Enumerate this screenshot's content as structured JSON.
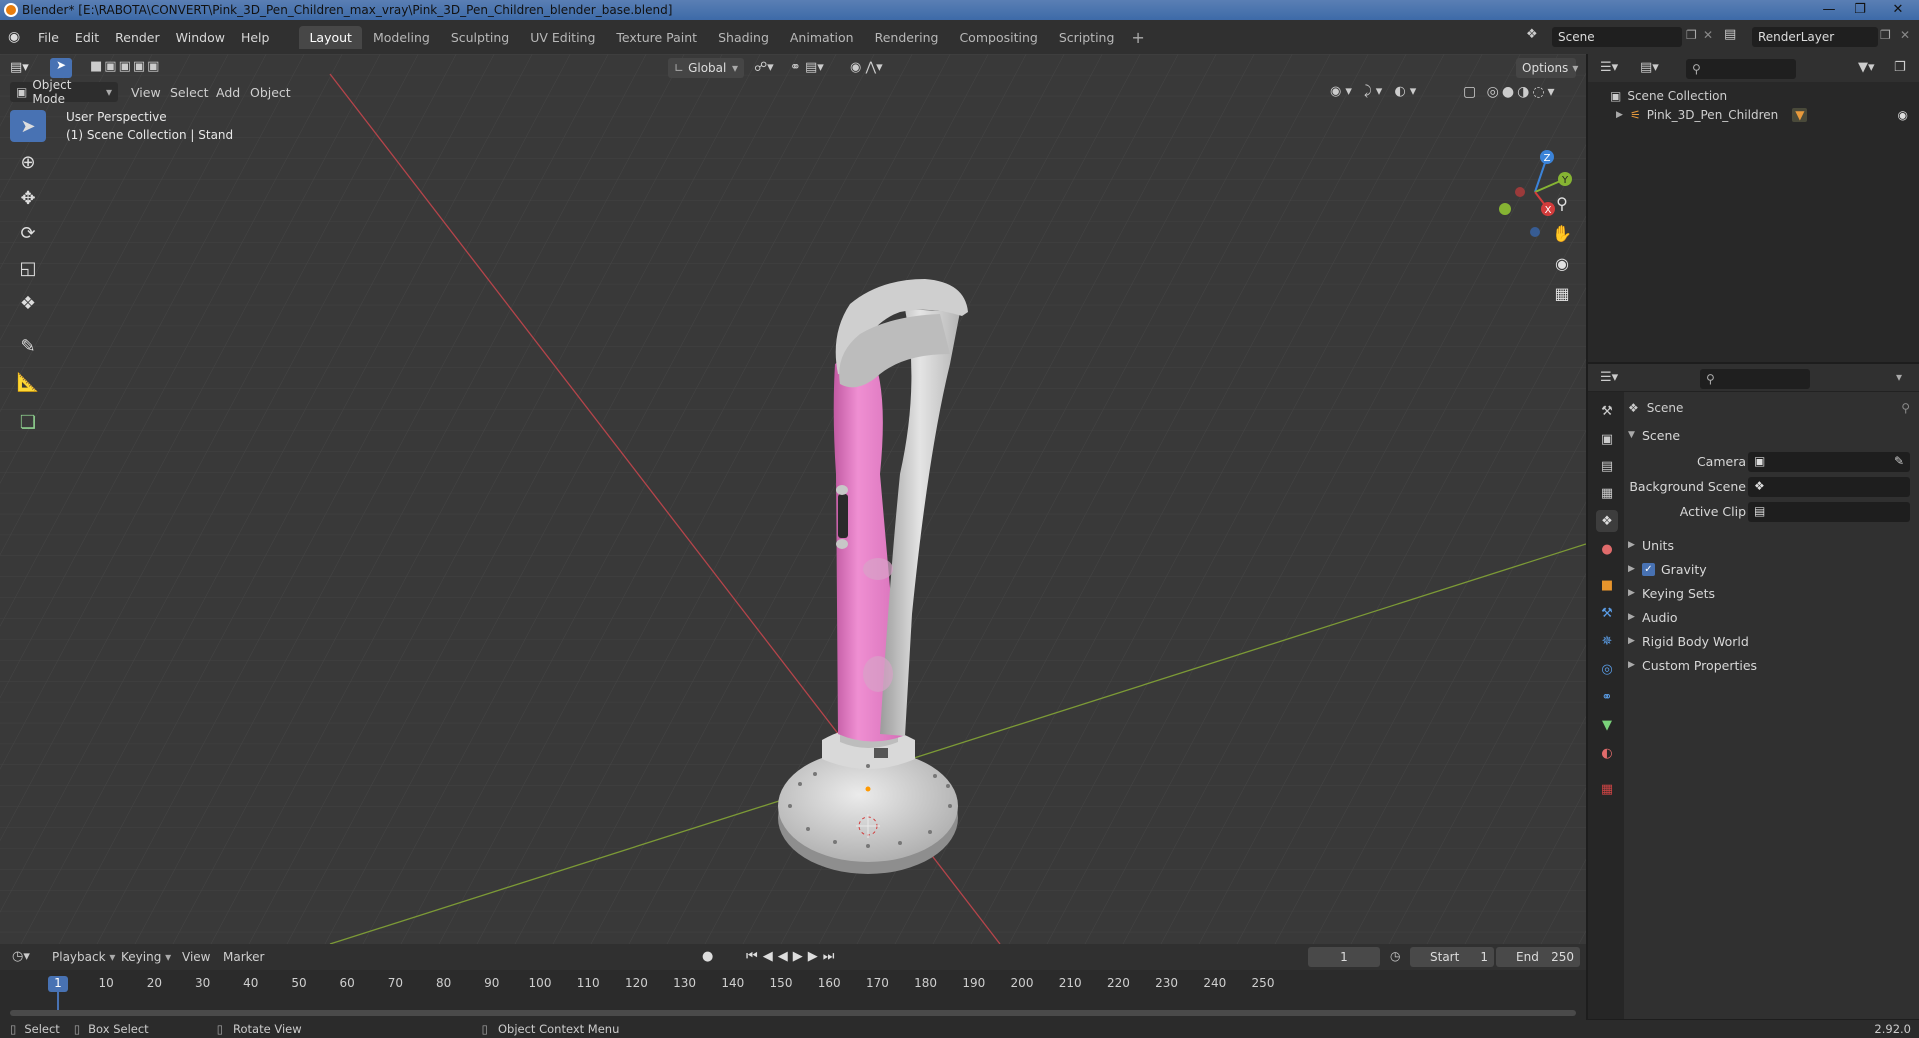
{
  "title_bar": {
    "text": "Blender* [E:\\RABOTA\\CONVERT\\Pink_3D_Pen_Children_max_vray\\Pink_3D_Pen_Children_blender_base.blend]"
  },
  "menu": [
    "File",
    "Edit",
    "Render",
    "Window",
    "Help"
  ],
  "workspaces": [
    "Layout",
    "Modeling",
    "Sculpting",
    "UV Editing",
    "Texture Paint",
    "Shading",
    "Animation",
    "Rendering",
    "Compositing",
    "Scripting"
  ],
  "active_workspace": "Layout",
  "scene_field": "Scene",
  "renderlayer_field": "RenderLayer",
  "viewport": {
    "transform_orientation": "Global",
    "options_label": "Options",
    "mode": "Object Mode",
    "header_menus": [
      "View",
      "Select",
      "Add",
      "Object"
    ],
    "overlay_line1": "User Perspective",
    "overlay_line2": "(1) Scene Collection | Stand",
    "axis_labels": {
      "x": "X",
      "y": "Y",
      "z": "Z"
    }
  },
  "outliner": {
    "root": "Scene Collection",
    "items": [
      {
        "name": "Pink_3D_Pen_Children"
      }
    ]
  },
  "properties": {
    "header": "Scene",
    "panel_title": "Scene",
    "fields": [
      {
        "label": "Camera"
      },
      {
        "label": "Background Scene"
      },
      {
        "label": "Active Clip"
      }
    ],
    "subpanels": [
      "Units",
      "Gravity",
      "Keying Sets",
      "Audio",
      "Rigid Body World",
      "Custom Properties"
    ],
    "gravity_checked": true
  },
  "timeline": {
    "menus": [
      "Playback",
      "Keying",
      "View",
      "Marker"
    ],
    "current_frame": "1",
    "start_label": "Start",
    "start_value": "1",
    "end_label": "End",
    "end_value": "250",
    "ticks": [
      "10",
      "20",
      "30",
      "40",
      "50",
      "60",
      "70",
      "80",
      "90",
      "100",
      "110",
      "120",
      "130",
      "140",
      "150",
      "160",
      "170",
      "180",
      "190",
      "200",
      "210",
      "220",
      "230",
      "240",
      "250"
    ]
  },
  "status_bar": {
    "select": "Select",
    "box_select": "Box Select",
    "rotate_view": "Rotate View",
    "context_menu": "Object Context Menu",
    "version": "2.92.0"
  },
  "colors": {
    "accent": "#4872b3",
    "pen_pink": "#e47ec4",
    "pen_grey": "#d4d4d4",
    "x_axis": "#d23c3c",
    "y_axis": "#86b433",
    "z_axis": "#3b83d8"
  }
}
